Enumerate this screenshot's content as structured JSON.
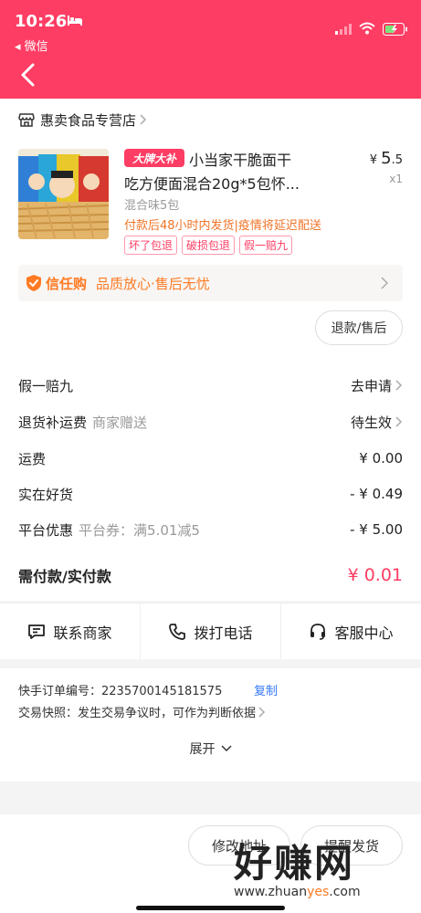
{
  "status": {
    "time": "10:26",
    "back_app": "◂ 微信"
  },
  "shop": {
    "name": "惠卖食品专营店"
  },
  "product": {
    "badge": "大牌大补",
    "title_line1": "小当家干脆面干",
    "title_line2": "吃方便面混合20g*5包怀...",
    "price_symbol": "¥",
    "price_int": "5",
    "price_dec": ".5",
    "qty": "x1",
    "variant": "混合味5包",
    "ship_note": "付款后48小时内发货|疫情将延迟配送",
    "tags": [
      "坏了包退",
      "破损包退",
      "假一赔九"
    ]
  },
  "trust": {
    "name": "信任购",
    "desc": "品质放心·售后无忧"
  },
  "refund_button": "退款/售后",
  "rows": {
    "fake_compensation": {
      "label": "假一赔九",
      "value": "去申请"
    },
    "return_shipping": {
      "label": "退货补运费",
      "sub": "商家赠送",
      "value": "待生效"
    },
    "shipping_fee": {
      "label": "运费",
      "value": "¥ 0.00"
    },
    "good_deal": {
      "label": "实在好货",
      "value": "- ¥ 0.49"
    },
    "platform_discount": {
      "label": "平台优惠",
      "sub": "平台券：满5.01减5",
      "value": "- ¥ 5.00"
    },
    "total": {
      "label": "需付款/实付款",
      "value": "¥ 0.01"
    }
  },
  "contact": {
    "merchant": "联系商家",
    "phone": "拨打电话",
    "service": "客服中心"
  },
  "details": {
    "order_no_label": "快手订单编号：",
    "order_no": "2235700145181575",
    "copy": "复制",
    "snapshot": "交易快照：发生交易争议时，可作为判断依据",
    "expand": "展开"
  },
  "bottom": {
    "modify_address": "修改地址",
    "remind_ship": "提醒发货"
  },
  "watermark": {
    "main": "好赚网",
    "url_pre": "www.zhuan",
    "url_mid": "yes",
    "url_post": ".com"
  },
  "colors": {
    "accent": "#fe3d64",
    "trust_orange": "#ff7a22",
    "link_blue": "#3478f6"
  }
}
